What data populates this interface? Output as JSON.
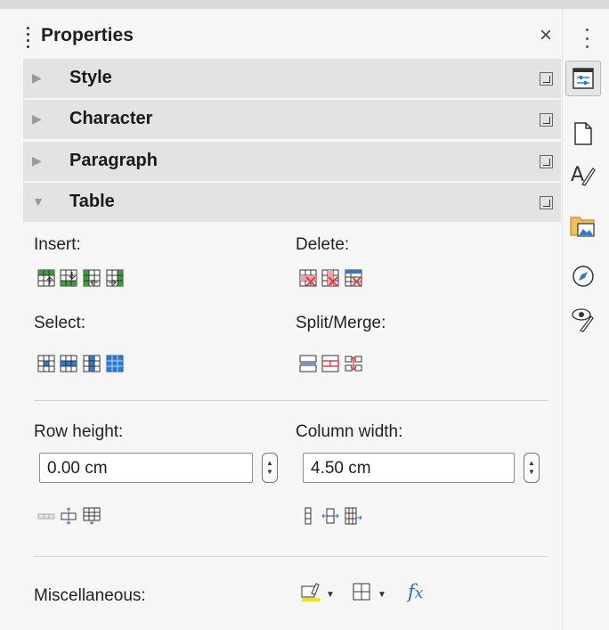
{
  "header": {
    "title": "Properties",
    "close_glyph": "×"
  },
  "sections": [
    {
      "label": "Style",
      "expanded": false
    },
    {
      "label": "Character",
      "expanded": false
    },
    {
      "label": "Paragraph",
      "expanded": false
    },
    {
      "label": "Table",
      "expanded": true
    }
  ],
  "table": {
    "insert_label": "Insert:",
    "delete_label": "Delete:",
    "select_label": "Select:",
    "split_merge_label": "Split/Merge:",
    "row_height_label": "Row height:",
    "row_height_value": "0.00 cm",
    "column_width_label": "Column width:",
    "column_width_value": "4.50 cm",
    "misc_label": "Miscellaneous:"
  },
  "deck": {
    "tabs": [
      "properties-icon",
      "page-icon",
      "styles-icon",
      "gallery-icon",
      "navigator-icon",
      "manage-changes-icon"
    ]
  },
  "colors": {
    "insert_green": "#3a9c3a",
    "delete_red": "#e04040",
    "select_blue": "#2b7bd6",
    "highlight_yellow": "#f5e400"
  }
}
